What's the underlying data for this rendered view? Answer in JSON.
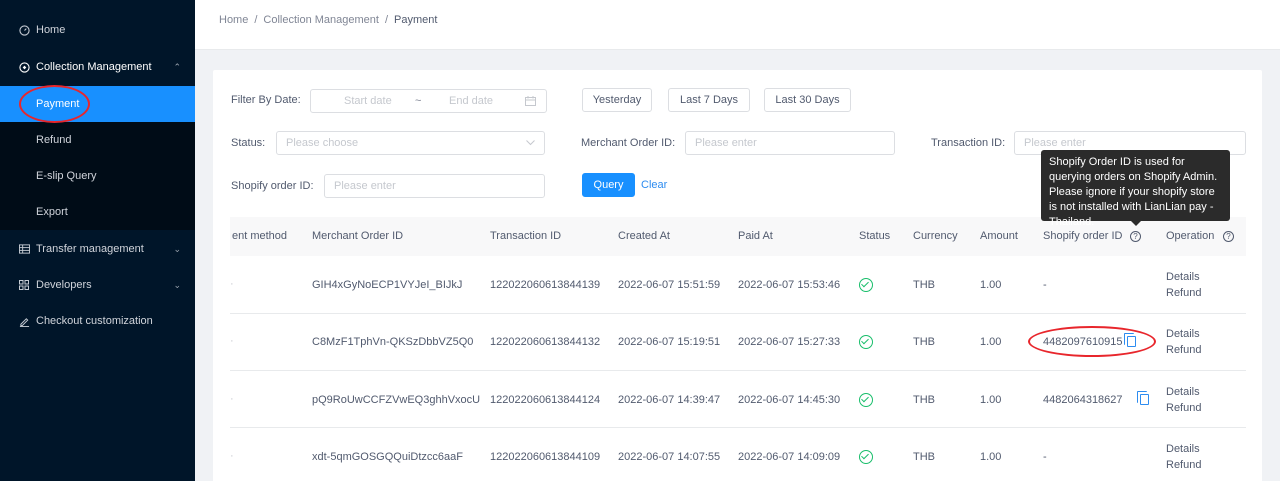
{
  "sidebar": {
    "items": [
      {
        "label": "Home",
        "icon": "dashboard-icon"
      },
      {
        "label": "Collection Management",
        "icon": "collection-icon"
      },
      {
        "label": "Payment"
      },
      {
        "label": "Refund"
      },
      {
        "label": "E-slip Query"
      },
      {
        "label": "Export"
      },
      {
        "label": "Transfer management",
        "icon": "table-icon"
      },
      {
        "label": "Developers",
        "icon": "grid-icon"
      },
      {
        "label": "Checkout customization",
        "icon": "edit-icon"
      }
    ]
  },
  "breadcrumb": {
    "home": "Home",
    "sep": "/",
    "section": "Collection Management",
    "current": "Payment"
  },
  "filters": {
    "date_label": "Filter By Date:",
    "start_placeholder": "Start date",
    "range_sep": "~",
    "end_placeholder": "End date",
    "yesterday": "Yesterday",
    "last7": "Last 7 Days",
    "last30": "Last 30 Days",
    "status_label": "Status:",
    "status_placeholder": "Please choose",
    "merchant_label": "Merchant Order ID:",
    "merchant_placeholder": "Please enter",
    "transaction_label": "Transaction ID:",
    "transaction_placeholder": "Please enter",
    "shopify_label": "Shopify order ID:",
    "shopify_placeholder": "Please enter",
    "query": "Query",
    "clear": "Clear"
  },
  "tooltip": {
    "text": "Shopify Order ID is used for querying orders on Shopify Admin. Please ignore if your shopify store is not installed with LianLian pay - Thailand."
  },
  "table": {
    "headers": {
      "method": "ent method",
      "merchant": "Merchant Order ID",
      "transaction": "Transaction ID",
      "created": "Created At",
      "paid": "Paid At",
      "status": "Status",
      "currency": "Currency",
      "amount": "Amount",
      "shopify": "Shopify order ID",
      "operation": "Operation"
    },
    "rows": [
      {
        "merchant": "GIH4xGyNoECP1VYJeI_BIJkJ",
        "transaction": "122022060613844139",
        "created": "2022-06-07 15:51:59",
        "paid": "2022-06-07 15:53:46",
        "currency": "THB",
        "amount": "1.00",
        "shopify": "-",
        "details": "Details",
        "refund": "Refund"
      },
      {
        "merchant": "C8MzF1TphVn-QKSzDbbVZ5Q0",
        "transaction": "122022060613844132",
        "created": "2022-06-07 15:19:51",
        "paid": "2022-06-07 15:27:33",
        "currency": "THB",
        "amount": "1.00",
        "shopify": "4482097610915",
        "details": "Details",
        "refund": "Refund"
      },
      {
        "merchant": "pQ9RoUwCCFZVwEQ3ghhVxocU",
        "transaction": "122022060613844124",
        "created": "2022-06-07 14:39:47",
        "paid": "2022-06-07 14:45:30",
        "currency": "THB",
        "amount": "1.00",
        "shopify": "4482064318627",
        "details": "Details",
        "refund": "Refund"
      },
      {
        "merchant": "xdt-5qmGOSGQQuiDtzcc6aaF",
        "transaction": "122022060613844109",
        "created": "2022-06-07 14:07:55",
        "paid": "2022-06-07 14:09:09",
        "currency": "THB",
        "amount": "1.00",
        "shopify": "-",
        "details": "Details",
        "refund": "Refund"
      }
    ]
  },
  "colors": {
    "accent": "#1890ff",
    "sidebar": "#001529",
    "success": "#19be6b",
    "annotation": "#e8262c"
  }
}
